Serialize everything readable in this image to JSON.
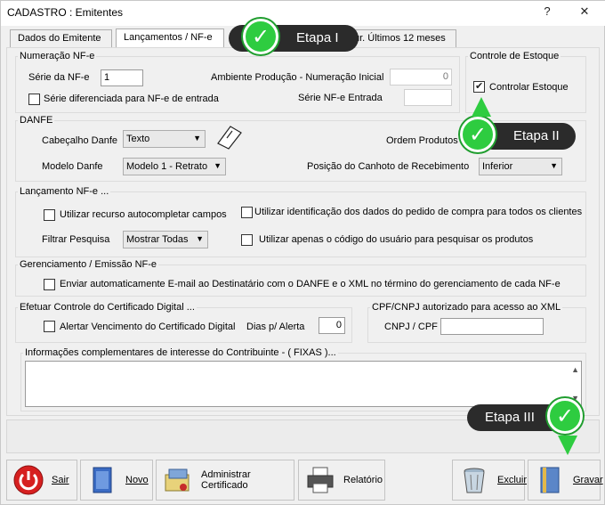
{
  "window": {
    "title": "CADASTRO : Emitentes",
    "help_label": "?",
    "close_label": "✕"
  },
  "tabs": [
    {
      "label": "Dados do Emitente"
    },
    {
      "label": "Lançamentos / NF-e"
    },
    {
      "label": "Fatur. Últimos 12 meses",
      "visible_text": "ur. Últimos 12 meses"
    }
  ],
  "nfe": {
    "legend": "Numeração NF-e",
    "serie_label": "Série da NF-e",
    "serie_value": "1",
    "ambiente_label": "Ambiente Produção - Numeração Inicial",
    "ambiente_value": "0",
    "serie_dif_label": "Série diferenciada para NF-e de entrada",
    "serie_entrada_label": "Série NF-e Entrada",
    "serie_entrada_value": ""
  },
  "estoque": {
    "legend": "Controle de Estoque",
    "controlar_label": "Controlar Estoque",
    "controlar_checked": true
  },
  "danfe": {
    "legend": "DANFE",
    "cabecalho_label": "Cabeçalho Danfe",
    "cabecalho_value": "Texto",
    "modelo_label": "Modelo Danfe",
    "modelo_value": "Modelo 1 - Retrato",
    "ordem_label": "Ordem Produtos",
    "posicao_label": "Posição do Canhoto de Recebimento",
    "posicao_value": "Inferior"
  },
  "lancamento": {
    "legend": "Lançamento NF-e ...",
    "autocompletar_label": "Utilizar recurso autocompletar campos",
    "identificacao_label": "Utilizar identificação dos dados do pedido de compra para todos os clientes",
    "filtrar_label": "Filtrar Pesquisa",
    "filtrar_value": "Mostrar Todas",
    "codigo_usuario_label": "Utilizar apenas o código do usuário para pesquisar os produtos"
  },
  "gerenciamento": {
    "legend": "Gerenciamento / Emissão NF-e",
    "email_label": "Enviar automaticamente E-mail ao Destinatário com o DANFE e o XML no término do gerenciamento de cada NF-e"
  },
  "certificado": {
    "legend": "Efetuar Controle do Certificado Digital ...",
    "alertar_label": "Alertar Vencimento do Certificado Digital",
    "dias_label": "Dias p/ Alerta",
    "dias_value": "0"
  },
  "cpf": {
    "legend": "CPF/CNPJ autorizado para acesso ao XML",
    "label": "CNPJ / CPF",
    "value": ""
  },
  "info": {
    "legend": "Informações complementares de interesse do Contribuinte - ( FIXAS )..."
  },
  "buttons": {
    "sair": "Sair",
    "novo": "Novo",
    "certificado": "Administrar Certificado",
    "relatorio": "Relatório",
    "excluir": "Excluir",
    "gravar": "Gravar"
  },
  "callouts": {
    "etapa1": "Etapa I",
    "etapa2": "Etapa II",
    "etapa3": "Etapa III"
  },
  "colors": {
    "accent_green": "#2ecc40",
    "callout_bg": "#2b2b2b"
  }
}
